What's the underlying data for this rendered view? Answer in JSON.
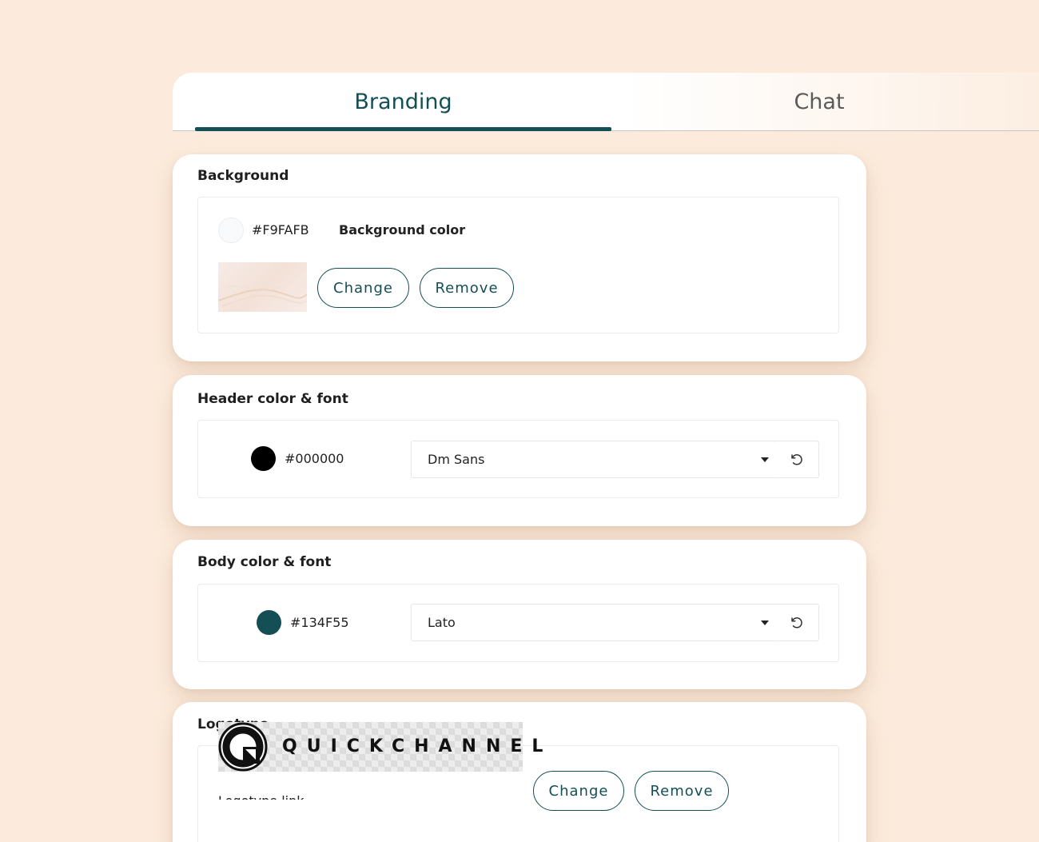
{
  "tabs": {
    "branding": "Branding",
    "chat": "Chat"
  },
  "background": {
    "title": "Background",
    "hex": "#F9FAFB",
    "label": "Background color",
    "change": "Change",
    "remove": "Remove"
  },
  "header": {
    "title": "Header color & font",
    "hex": "#000000",
    "font": "Dm Sans"
  },
  "body": {
    "title": "Body color & font",
    "hex": "#134F55",
    "font": "Lato"
  },
  "logotype": {
    "title": "Logotype",
    "logo_text": "QUICKCHANNEL",
    "change": "Change",
    "remove": "Remove",
    "clipped_label": "Logotype link"
  },
  "colors": {
    "accent": "#134f55",
    "page_bg": "#fcebdc",
    "background_swatch": "#F9FAFB",
    "header_swatch": "#000000",
    "body_swatch": "#134F55"
  },
  "icons": {
    "reset": "reset-icon",
    "caret": "caret-down-icon"
  }
}
